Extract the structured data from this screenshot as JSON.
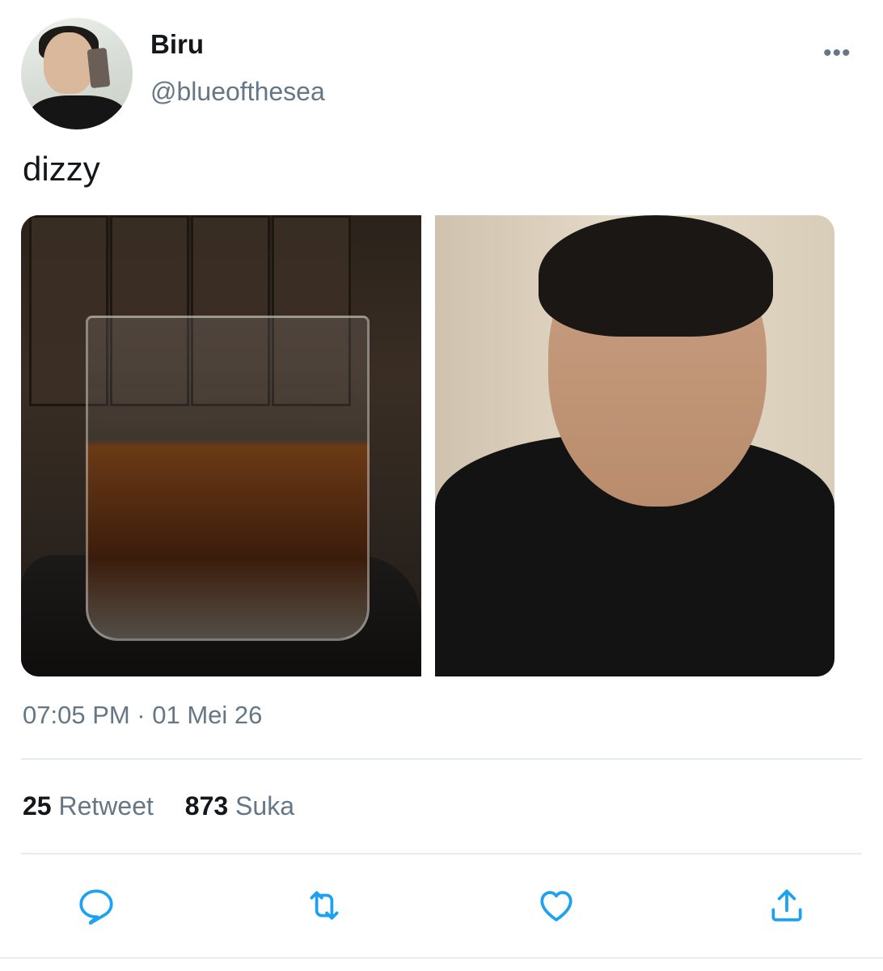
{
  "author": {
    "display_name": "Biru",
    "handle": "@blueofthesea"
  },
  "tweet": {
    "text": "dizzy",
    "timestamp": "07:05 PM · 01 Mei 26"
  },
  "stats": {
    "retweets_count": "25",
    "retweets_label": "Retweet",
    "likes_count": "873",
    "likes_label": "Suka"
  },
  "icons": {
    "more": "more-icon",
    "reply": "reply-icon",
    "retweet": "retweet-icon",
    "like": "heart-icon",
    "share": "share-icon"
  },
  "colors": {
    "text": "#14171a",
    "secondary": "#657786",
    "icon": "#1da1f2",
    "divider": "#e6ecf0"
  }
}
